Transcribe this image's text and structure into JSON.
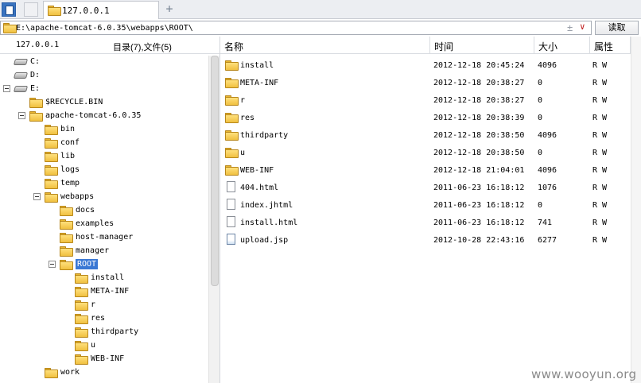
{
  "tab": {
    "label": "127.0.0.1",
    "new_tab": "+"
  },
  "address": {
    "path": "E:\\apache-tomcat-6.0.35\\webapps\\ROOT\\",
    "clear": "±",
    "dropdown": "∨",
    "read_button": "读取"
  },
  "left_header": {
    "host": "127.0.0.1",
    "count": "目录(7),文件(5)"
  },
  "tree": [
    {
      "label": "C:",
      "type": "drive"
    },
    {
      "label": "D:",
      "type": "drive"
    },
    {
      "label": "E:",
      "type": "drive",
      "expanded": true
    },
    {
      "label": "$RECYCLE.BIN",
      "type": "folder"
    },
    {
      "label": "apache-tomcat-6.0.35",
      "type": "folder",
      "expanded": true
    },
    {
      "label": "bin",
      "type": "folder"
    },
    {
      "label": "conf",
      "type": "folder"
    },
    {
      "label": "lib",
      "type": "folder"
    },
    {
      "label": "logs",
      "type": "folder"
    },
    {
      "label": "temp",
      "type": "folder"
    },
    {
      "label": "webapps",
      "type": "folder",
      "expanded": true
    },
    {
      "label": "docs",
      "type": "folder"
    },
    {
      "label": "examples",
      "type": "folder"
    },
    {
      "label": "host-manager",
      "type": "folder"
    },
    {
      "label": "manager",
      "type": "folder"
    },
    {
      "label": "ROOT",
      "type": "folder",
      "expanded": true,
      "selected": true
    },
    {
      "label": "install",
      "type": "folder"
    },
    {
      "label": "META-INF",
      "type": "folder"
    },
    {
      "label": "r",
      "type": "folder"
    },
    {
      "label": "res",
      "type": "folder"
    },
    {
      "label": "thirdparty",
      "type": "folder"
    },
    {
      "label": "u",
      "type": "folder"
    },
    {
      "label": "WEB-INF",
      "type": "folder"
    },
    {
      "label": "work",
      "type": "folder"
    }
  ],
  "columns": {
    "name": "名称",
    "time": "时间",
    "size": "大小",
    "attr": "属性"
  },
  "files": [
    {
      "name": "install",
      "time": "2012-12-18 20:45:24",
      "size": "4096",
      "attr": "R W",
      "type": "folder"
    },
    {
      "name": "META-INF",
      "time": "2012-12-18 20:38:27",
      "size": "0",
      "attr": "R W",
      "type": "folder"
    },
    {
      "name": "r",
      "time": "2012-12-18 20:38:27",
      "size": "0",
      "attr": "R W",
      "type": "folder"
    },
    {
      "name": "res",
      "time": "2012-12-18 20:38:39",
      "size": "0",
      "attr": "R W",
      "type": "folder"
    },
    {
      "name": "thirdparty",
      "time": "2012-12-18 20:38:50",
      "size": "4096",
      "attr": "R W",
      "type": "folder"
    },
    {
      "name": "u",
      "time": "2012-12-18 20:38:50",
      "size": "0",
      "attr": "R W",
      "type": "folder"
    },
    {
      "name": "WEB-INF",
      "time": "2012-12-18 21:04:01",
      "size": "4096",
      "attr": "R W",
      "type": "folder"
    },
    {
      "name": "404.html",
      "time": "2011-06-23 16:18:12",
      "size": "1076",
      "attr": "R W",
      "type": "file"
    },
    {
      "name": "index.jhtml",
      "time": "2011-06-23 16:18:12",
      "size": "0",
      "attr": "R W",
      "type": "file"
    },
    {
      "name": "install.html",
      "time": "2011-06-23 16:18:12",
      "size": "741",
      "attr": "R W",
      "type": "file"
    },
    {
      "name": "upload.jsp",
      "time": "2012-10-28 22:43:16",
      "size": "6277",
      "attr": "R W",
      "type": "jsp"
    }
  ],
  "watermark": "www.wooyun.org"
}
